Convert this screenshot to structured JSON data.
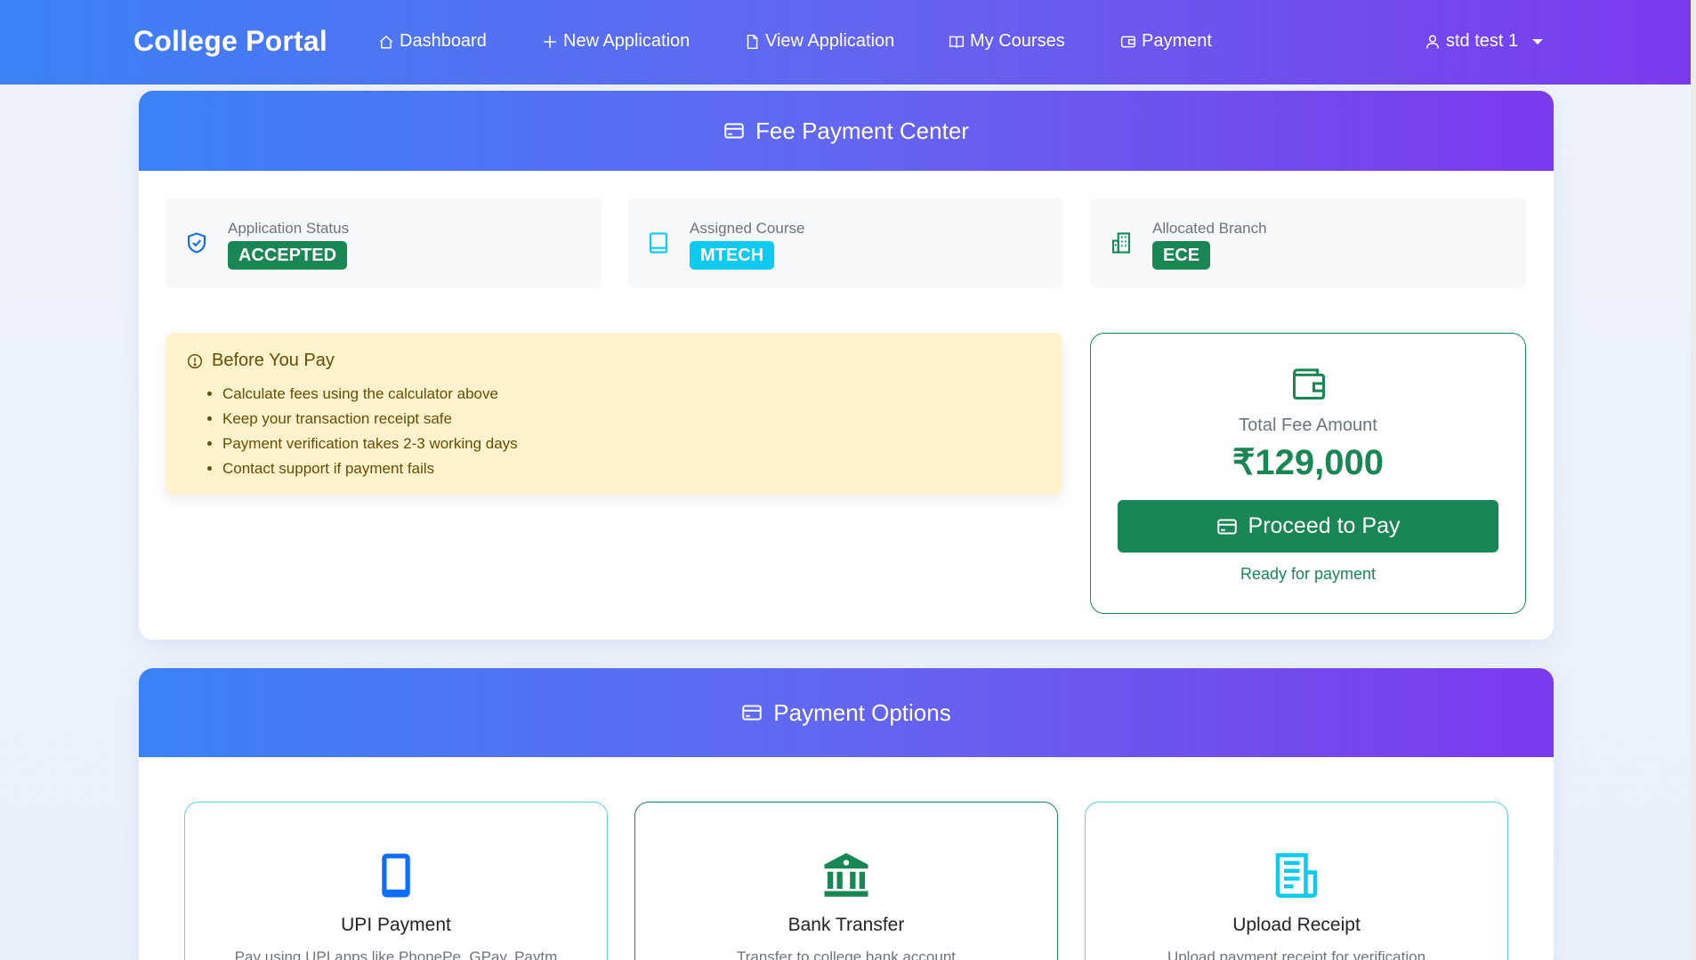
{
  "nav": {
    "brand": "College Portal",
    "items": [
      {
        "label": "Dashboard",
        "icon": "house-icon"
      },
      {
        "label": "New Application",
        "icon": "plus-icon"
      },
      {
        "label": "View Application",
        "icon": "file-icon"
      },
      {
        "label": "My Courses",
        "icon": "book-open-icon"
      },
      {
        "label": "Payment",
        "icon": "wallet-icon"
      }
    ],
    "user": "std test 1"
  },
  "fee_center": {
    "title": "Fee Payment Center",
    "tiles": [
      {
        "label": "Application Status",
        "value": "ACCEPTED",
        "color": "#198754",
        "icon": "shield-check-icon"
      },
      {
        "label": "Assigned Course",
        "value": "MTECH",
        "color": "#0dcaf0",
        "icon": "book-icon"
      },
      {
        "label": "Allocated Branch",
        "value": "ECE",
        "color": "#198754",
        "icon": "building-icon"
      }
    ],
    "notice": {
      "title": "Before You Pay",
      "items": [
        "Calculate fees using the calculator above",
        "Keep your transaction receipt safe",
        "Payment verification takes 2-3 working days",
        "Contact support if payment fails"
      ]
    },
    "fee": {
      "label": "Total Fee Amount",
      "amount": "₹129,000",
      "button": "Proceed to Pay",
      "status": "Ready for payment"
    }
  },
  "payment_options": {
    "title": "Payment Options",
    "options": [
      {
        "title": "UPI Payment",
        "desc": "Pay using UPI apps like PhonePe, GPay, Paytm",
        "color": "#0d6efd",
        "border": "#5ad3e8",
        "icon": "phone-icon"
      },
      {
        "title": "Bank Transfer",
        "desc": "Transfer to college bank account",
        "color": "#198754",
        "border": "#198754",
        "icon": "bank-icon"
      },
      {
        "title": "Upload Receipt",
        "desc": "Upload payment receipt for verification",
        "color": "#0dcaf0",
        "border": "#5ad3e8",
        "icon": "receipt-icon"
      }
    ]
  },
  "colors": {
    "accent_start": "#3b82f6",
    "accent_end": "#7c3aed",
    "success": "#198754",
    "info": "#0dcaf0"
  }
}
